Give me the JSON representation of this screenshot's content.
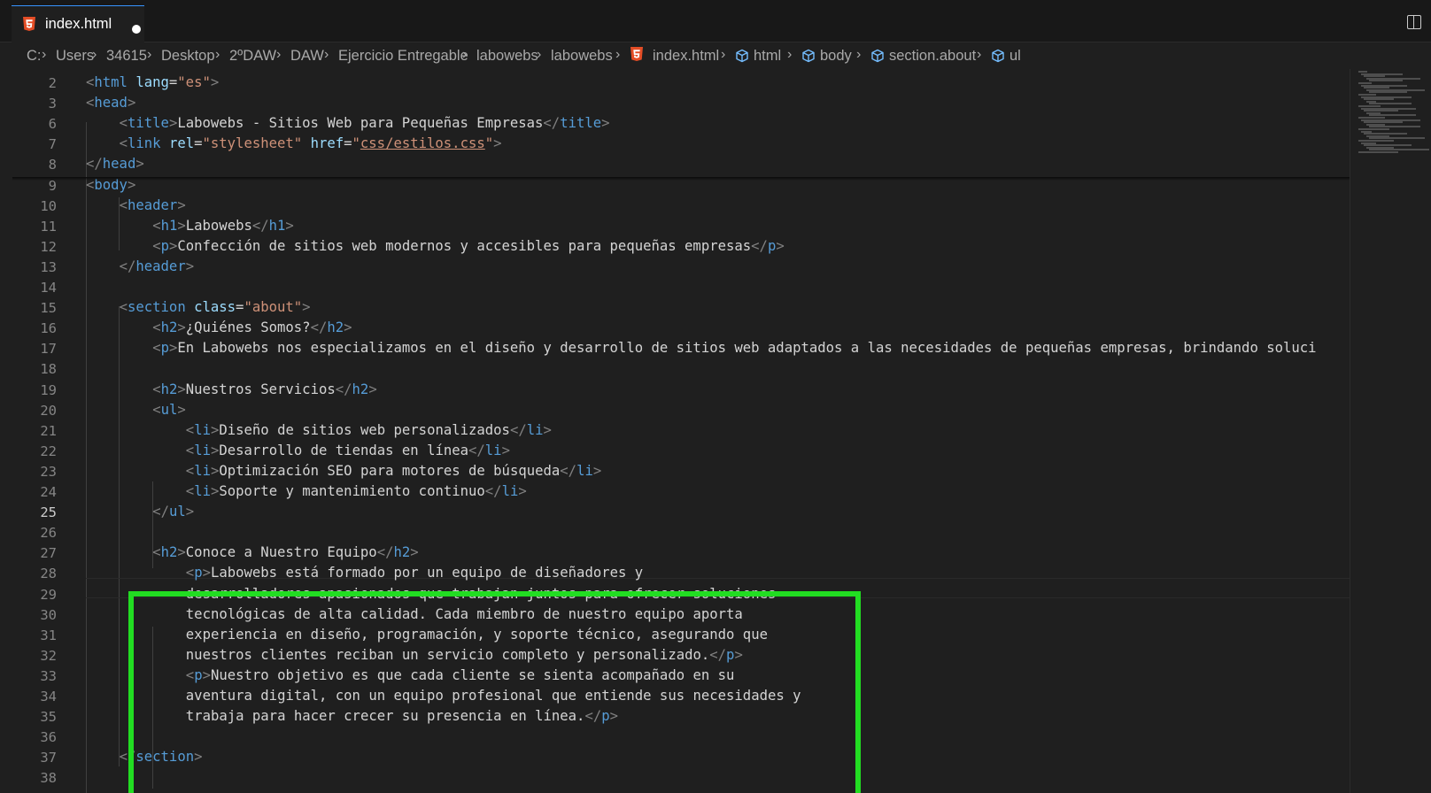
{
  "tab": {
    "label": "index.html",
    "unsaved": true
  },
  "breadcrumb": [
    {
      "label": "C:",
      "icon": null
    },
    {
      "label": "Users",
      "icon": null
    },
    {
      "label": "34615",
      "icon": null
    },
    {
      "label": "Desktop",
      "icon": null
    },
    {
      "label": "2ºDAW",
      "icon": null
    },
    {
      "label": "DAW",
      "icon": null
    },
    {
      "label": "Ejercicio Entregable",
      "icon": null
    },
    {
      "label": "labowebs",
      "icon": null
    },
    {
      "label": "labowebs",
      "icon": null
    },
    {
      "label": "index.html",
      "icon": "html5-icon"
    },
    {
      "label": "html",
      "icon": "cube-icon"
    },
    {
      "label": "body",
      "icon": "cube-icon"
    },
    {
      "label": "section.about",
      "icon": "cube-icon"
    },
    {
      "label": "ul",
      "icon": "cube-icon"
    }
  ],
  "colors": {
    "html5": "#e44d26",
    "highlight": "#22dd22",
    "tag": "#569cd6",
    "attribute": "#9cdcfe",
    "string": "#ce9178",
    "punctuation": "#808080",
    "text": "#d4d4d4"
  },
  "current_line": 25,
  "lines": [
    {
      "n": 2,
      "indent": 0,
      "tokens": [
        [
          "pun",
          "<"
        ],
        [
          "tag",
          "html"
        ],
        [
          "txt",
          " "
        ],
        [
          "attr",
          "lang"
        ],
        [
          "txt",
          "="
        ],
        [
          "str",
          "\"es\""
        ],
        [
          "pun",
          ">"
        ]
      ]
    },
    {
      "n": 3,
      "indent": 0,
      "tokens": [
        [
          "pun",
          "<"
        ],
        [
          "tag",
          "head"
        ],
        [
          "pun",
          ">"
        ]
      ]
    },
    {
      "n": 6,
      "indent": 1,
      "tokens": [
        [
          "pun",
          "<"
        ],
        [
          "tag",
          "title"
        ],
        [
          "pun",
          ">"
        ],
        [
          "txt",
          "Labowebs - Sitios Web para Pequeñas Empresas"
        ],
        [
          "pun",
          "</"
        ],
        [
          "tag",
          "title"
        ],
        [
          "pun",
          ">"
        ]
      ]
    },
    {
      "n": 7,
      "indent": 1,
      "tokens": [
        [
          "pun",
          "<"
        ],
        [
          "tag",
          "link"
        ],
        [
          "txt",
          " "
        ],
        [
          "attr",
          "rel"
        ],
        [
          "txt",
          "="
        ],
        [
          "str",
          "\"stylesheet\""
        ],
        [
          "txt",
          " "
        ],
        [
          "attr",
          "href"
        ],
        [
          "txt",
          "="
        ],
        [
          "str",
          "\""
        ],
        [
          "link",
          "css/estilos.css"
        ],
        [
          "str",
          "\""
        ],
        [
          "pun",
          ">"
        ]
      ]
    },
    {
      "n": 8,
      "indent": 0,
      "tokens": [
        [
          "pun",
          "</"
        ],
        [
          "tag",
          "head"
        ],
        [
          "pun",
          ">"
        ]
      ]
    },
    {
      "n": 9,
      "indent": 0,
      "tokens": [
        [
          "pun",
          "<"
        ],
        [
          "tag",
          "body"
        ],
        [
          "pun",
          ">"
        ]
      ]
    },
    {
      "n": 10,
      "indent": 1,
      "tokens": [
        [
          "pun",
          "<"
        ],
        [
          "tag",
          "header"
        ],
        [
          "pun",
          ">"
        ]
      ]
    },
    {
      "n": 11,
      "indent": 2,
      "tokens": [
        [
          "pun",
          "<"
        ],
        [
          "tag",
          "h1"
        ],
        [
          "pun",
          ">"
        ],
        [
          "txt",
          "Labowebs"
        ],
        [
          "pun",
          "</"
        ],
        [
          "tag",
          "h1"
        ],
        [
          "pun",
          ">"
        ]
      ]
    },
    {
      "n": 12,
      "indent": 2,
      "tokens": [
        [
          "pun",
          "<"
        ],
        [
          "tag",
          "p"
        ],
        [
          "pun",
          ">"
        ],
        [
          "txt",
          "Confección de sitios web modernos y accesibles para pequeñas empresas"
        ],
        [
          "pun",
          "</"
        ],
        [
          "tag",
          "p"
        ],
        [
          "pun",
          ">"
        ]
      ]
    },
    {
      "n": 13,
      "indent": 1,
      "tokens": [
        [
          "pun",
          "</"
        ],
        [
          "tag",
          "header"
        ],
        [
          "pun",
          ">"
        ]
      ]
    },
    {
      "n": 14,
      "indent": 0,
      "tokens": []
    },
    {
      "n": 15,
      "indent": 1,
      "tokens": [
        [
          "pun",
          "<"
        ],
        [
          "tag",
          "section"
        ],
        [
          "txt",
          " "
        ],
        [
          "attr",
          "class"
        ],
        [
          "txt",
          "="
        ],
        [
          "str",
          "\"about\""
        ],
        [
          "pun",
          ">"
        ]
      ]
    },
    {
      "n": 16,
      "indent": 2,
      "tokens": [
        [
          "pun",
          "<"
        ],
        [
          "tag",
          "h2"
        ],
        [
          "pun",
          ">"
        ],
        [
          "txt",
          "¿Quiénes Somos?"
        ],
        [
          "pun",
          "</"
        ],
        [
          "tag",
          "h2"
        ],
        [
          "pun",
          ">"
        ]
      ]
    },
    {
      "n": 17,
      "indent": 2,
      "tokens": [
        [
          "pun",
          "<"
        ],
        [
          "tag",
          "p"
        ],
        [
          "pun",
          ">"
        ],
        [
          "txt",
          "En Labowebs nos especializamos en el diseño y desarrollo de sitios web adaptados a las necesidades de pequeñas empresas, brindando soluci"
        ]
      ]
    },
    {
      "n": 18,
      "indent": 0,
      "tokens": []
    },
    {
      "n": 19,
      "indent": 2,
      "tokens": [
        [
          "pun",
          "<"
        ],
        [
          "tag",
          "h2"
        ],
        [
          "pun",
          ">"
        ],
        [
          "txt",
          "Nuestros Servicios"
        ],
        [
          "pun",
          "</"
        ],
        [
          "tag",
          "h2"
        ],
        [
          "pun",
          ">"
        ]
      ]
    },
    {
      "n": 20,
      "indent": 2,
      "tokens": [
        [
          "pun",
          "<"
        ],
        [
          "tag",
          "ul"
        ],
        [
          "pun",
          ">"
        ]
      ]
    },
    {
      "n": 21,
      "indent": 3,
      "tokens": [
        [
          "pun",
          "<"
        ],
        [
          "tag",
          "li"
        ],
        [
          "pun",
          ">"
        ],
        [
          "txt",
          "Diseño de sitios web personalizados"
        ],
        [
          "pun",
          "</"
        ],
        [
          "tag",
          "li"
        ],
        [
          "pun",
          ">"
        ]
      ]
    },
    {
      "n": 22,
      "indent": 3,
      "tokens": [
        [
          "pun",
          "<"
        ],
        [
          "tag",
          "li"
        ],
        [
          "pun",
          ">"
        ],
        [
          "txt",
          "Desarrollo de tiendas en línea"
        ],
        [
          "pun",
          "</"
        ],
        [
          "tag",
          "li"
        ],
        [
          "pun",
          ">"
        ]
      ]
    },
    {
      "n": 23,
      "indent": 3,
      "tokens": [
        [
          "pun",
          "<"
        ],
        [
          "tag",
          "li"
        ],
        [
          "pun",
          ">"
        ],
        [
          "txt",
          "Optimización SEO para motores de búsqueda"
        ],
        [
          "pun",
          "</"
        ],
        [
          "tag",
          "li"
        ],
        [
          "pun",
          ">"
        ]
      ]
    },
    {
      "n": 24,
      "indent": 3,
      "tokens": [
        [
          "pun",
          "<"
        ],
        [
          "tag",
          "li"
        ],
        [
          "pun",
          ">"
        ],
        [
          "txt",
          "Soporte y mantenimiento continuo"
        ],
        [
          "pun",
          "</"
        ],
        [
          "tag",
          "li"
        ],
        [
          "pun",
          ">"
        ]
      ]
    },
    {
      "n": 25,
      "indent": 2,
      "tokens": [
        [
          "pun",
          "</"
        ],
        [
          "tag",
          "ul"
        ],
        [
          "pun",
          ">"
        ]
      ]
    },
    {
      "n": 26,
      "indent": 0,
      "tokens": []
    },
    {
      "n": 27,
      "indent": 2,
      "tokens": [
        [
          "pun",
          "<"
        ],
        [
          "tag",
          "h2"
        ],
        [
          "pun",
          ">"
        ],
        [
          "txt",
          "Conoce a Nuestro Equipo"
        ],
        [
          "pun",
          "</"
        ],
        [
          "tag",
          "h2"
        ],
        [
          "pun",
          ">"
        ]
      ]
    },
    {
      "n": 28,
      "indent": 3,
      "tokens": [
        [
          "pun",
          "<"
        ],
        [
          "tag",
          "p"
        ],
        [
          "pun",
          ">"
        ],
        [
          "txt",
          "Labowebs está formado por un equipo de diseñadores y"
        ]
      ]
    },
    {
      "n": 29,
      "indent": 3,
      "tokens": [
        [
          "txt",
          "desarrolladores apasionados que trabajan juntos para ofrecer soluciones"
        ]
      ]
    },
    {
      "n": 30,
      "indent": 3,
      "tokens": [
        [
          "txt",
          "tecnológicas de alta calidad. Cada miembro de nuestro equipo aporta"
        ]
      ]
    },
    {
      "n": 31,
      "indent": 3,
      "tokens": [
        [
          "txt",
          "experiencia en diseño, programación, y soporte técnico, asegurando que"
        ]
      ]
    },
    {
      "n": 32,
      "indent": 3,
      "tokens": [
        [
          "txt",
          "nuestros clientes reciban un servicio completo y personalizado."
        ],
        [
          "pun",
          "</"
        ],
        [
          "tag",
          "p"
        ],
        [
          "pun",
          ">"
        ]
      ]
    },
    {
      "n": 33,
      "indent": 3,
      "tokens": [
        [
          "pun",
          "<"
        ],
        [
          "tag",
          "p"
        ],
        [
          "pun",
          ">"
        ],
        [
          "txt",
          "Nuestro objetivo es que cada cliente se sienta acompañado en su"
        ]
      ]
    },
    {
      "n": 34,
      "indent": 3,
      "tokens": [
        [
          "txt",
          "aventura digital, con un equipo profesional que entiende sus necesidades y"
        ]
      ]
    },
    {
      "n": 35,
      "indent": 3,
      "tokens": [
        [
          "txt",
          "trabaja para hacer crecer su presencia en línea."
        ],
        [
          "pun",
          "</"
        ],
        [
          "tag",
          "p"
        ],
        [
          "pun",
          ">"
        ]
      ]
    },
    {
      "n": 36,
      "indent": 0,
      "tokens": []
    },
    {
      "n": 37,
      "indent": 1,
      "tokens": [
        [
          "pun",
          "</"
        ],
        [
          "tag",
          "section"
        ],
        [
          "pun",
          ">"
        ]
      ]
    },
    {
      "n": 38,
      "indent": 0,
      "tokens": []
    }
  ]
}
